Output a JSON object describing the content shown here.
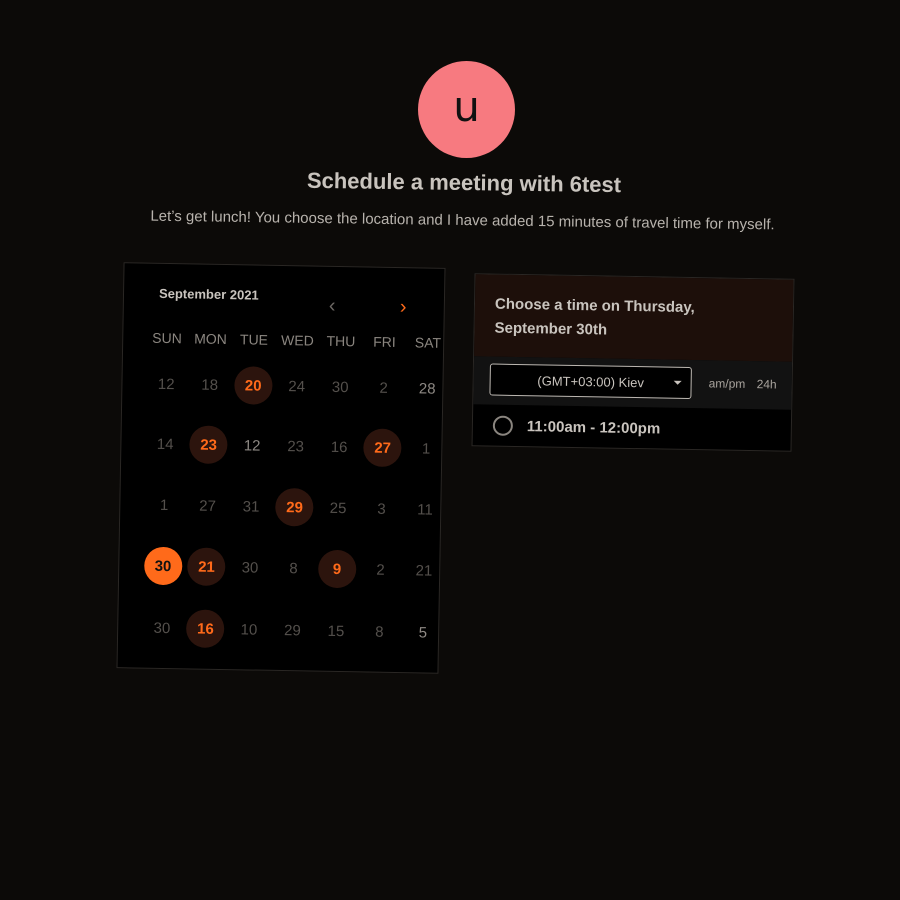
{
  "host": {
    "avatar_letter": "u",
    "avatar_color": "#f77a80",
    "title": "Schedule a meeting with 6test",
    "description": "Let’s get lunch! You choose the location and I have added 15 minutes of travel time for myself."
  },
  "calendar": {
    "month_label": "September 2021",
    "prev_icon": "chevron-left-icon",
    "next_icon": "chevron-right-icon",
    "weekdays": [
      "SUN",
      "MON",
      "TUE",
      "WED",
      "THU",
      "FRI",
      "SAT"
    ],
    "weeks": [
      [
        {
          "d": "12",
          "s": "off"
        },
        {
          "d": "18",
          "s": "off"
        },
        {
          "d": "20",
          "s": "avail"
        },
        {
          "d": "24",
          "s": "off"
        },
        {
          "d": "30",
          "s": "off"
        },
        {
          "d": "2",
          "s": "off"
        },
        {
          "d": "28",
          "s": "light"
        }
      ],
      [
        {
          "d": "14",
          "s": "off"
        },
        {
          "d": "23",
          "s": "avail"
        },
        {
          "d": "12",
          "s": "light"
        },
        {
          "d": "23",
          "s": "off"
        },
        {
          "d": "16",
          "s": "off"
        },
        {
          "d": "27",
          "s": "avail"
        },
        {
          "d": "1",
          "s": "off"
        }
      ],
      [
        {
          "d": "1",
          "s": "off"
        },
        {
          "d": "27",
          "s": "off"
        },
        {
          "d": "31",
          "s": "off"
        },
        {
          "d": "29",
          "s": "avail"
        },
        {
          "d": "25",
          "s": "off"
        },
        {
          "d": "3",
          "s": "off"
        },
        {
          "d": "11",
          "s": "off"
        }
      ],
      [
        {
          "d": "30",
          "s": "selected"
        },
        {
          "d": "21",
          "s": "avail"
        },
        {
          "d": "30",
          "s": "off"
        },
        {
          "d": "8",
          "s": "off"
        },
        {
          "d": "9",
          "s": "avail"
        },
        {
          "d": "2",
          "s": "off"
        },
        {
          "d": "21",
          "s": "off"
        }
      ],
      [
        {
          "d": "30",
          "s": "off"
        },
        {
          "d": "16",
          "s": "avail"
        },
        {
          "d": "10",
          "s": "off"
        },
        {
          "d": "29",
          "s": "off"
        },
        {
          "d": "15",
          "s": "off"
        },
        {
          "d": "8",
          "s": "off"
        },
        {
          "d": "5",
          "s": "light"
        }
      ]
    ],
    "accent_color": "#ff6a1a"
  },
  "times": {
    "header": "Choose a time on Thursday, September 30th",
    "timezone": "(GMT+03:00) Kiev",
    "format_ampm": "am/pm",
    "format_24h": "24h",
    "slots": [
      "11:00am - 12:00pm"
    ]
  }
}
